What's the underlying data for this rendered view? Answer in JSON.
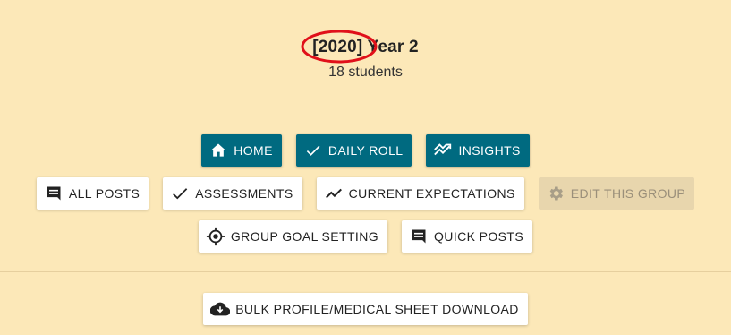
{
  "header": {
    "year_tag": "[2020]",
    "group_name": "Year 2",
    "student_count": "18 students"
  },
  "annotation": {
    "color": "#e0101a"
  },
  "colors": {
    "background": "#fce8b8",
    "primary": "#006a80",
    "disabled_bg": "#e8d6ad"
  },
  "nav": {
    "home": "HOME",
    "daily_roll": "DAILY ROLL",
    "insights": "INSIGHTS"
  },
  "actions": {
    "all_posts": "ALL POSTS",
    "assessments": "ASSESSMENTS",
    "current_expectations": "CURRENT EXPECTATIONS",
    "edit_group": "EDIT THIS GROUP",
    "group_goal_setting": "GROUP GOAL SETTING",
    "quick_posts": "QUICK POSTS"
  },
  "downloads": {
    "bulk_profile": "BULK PROFILE/MEDICAL SHEET DOWNLOAD"
  },
  "icons": {
    "home": "home-icon",
    "daily_roll": "check-icon",
    "insights": "insights-icon",
    "all_posts": "comment-icon",
    "assessments": "check-icon",
    "current_expectations": "trend-icon",
    "edit_group": "gear-icon",
    "group_goal_setting": "target-icon",
    "quick_posts": "comment-icon",
    "bulk_profile": "cloud-download-icon"
  }
}
